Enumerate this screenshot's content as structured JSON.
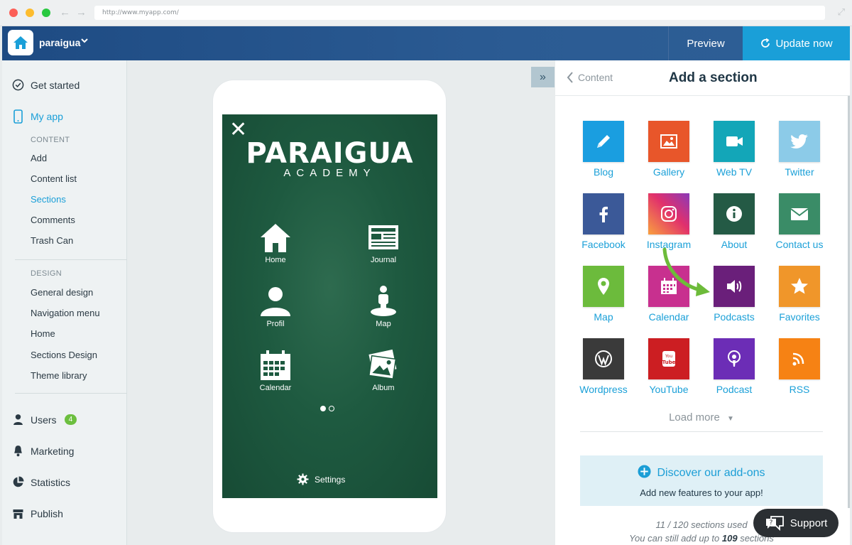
{
  "browser": {
    "url": "http://www.myapp.com/"
  },
  "header": {
    "app_name": "paraigua",
    "preview": "Preview",
    "update": "Update now"
  },
  "sidebar": {
    "get_started": "Get started",
    "my_app": "My app",
    "content_head": "CONTENT",
    "content_items": [
      "Add",
      "Content list",
      "Sections",
      "Comments",
      "Trash Can"
    ],
    "design_head": "DESIGN",
    "design_items": [
      "General design",
      "Navigation menu",
      "Home",
      "Sections Design",
      "Theme library"
    ],
    "users": "Users",
    "users_count": "4",
    "marketing": "Marketing",
    "statistics": "Statistics",
    "publish": "Publish"
  },
  "phone": {
    "brand": "PARAIGUA",
    "brand_sub": "ACADEMY",
    "items": [
      "Home",
      "Journal",
      "Profil",
      "Map",
      "Calendar",
      "Album"
    ],
    "settings": "Settings"
  },
  "panel": {
    "back": "Content",
    "title": "Add a section",
    "tiles": [
      {
        "label": "Blog",
        "color": "#1a9ee0",
        "icon": "pencil-icon"
      },
      {
        "label": "Gallery",
        "color": "#e8562a",
        "icon": "image-icon"
      },
      {
        "label": "Web TV",
        "color": "#13a6b8",
        "icon": "video-camera-icon"
      },
      {
        "label": "Twitter",
        "color": "#8ccbe8",
        "icon": "twitter-icon"
      },
      {
        "label": "Facebook",
        "color": "#3b5998",
        "icon": "facebook-icon"
      },
      {
        "label": "Instagram",
        "color": "#e1306c",
        "icon": "instagram-icon"
      },
      {
        "label": "About",
        "color": "#245a45",
        "icon": "info-icon"
      },
      {
        "label": "Contact us",
        "color": "#3a8c67",
        "icon": "envelope-icon"
      },
      {
        "label": "Map",
        "color": "#6cbb3c",
        "icon": "map-pin-icon"
      },
      {
        "label": "Calendar",
        "color": "#c8308f",
        "icon": "calendar-icon"
      },
      {
        "label": "Podcasts",
        "color": "#6a1f7a",
        "icon": "speaker-icon"
      },
      {
        "label": "Favorites",
        "color": "#f0962a",
        "icon": "star-icon"
      },
      {
        "label": "Wordpress",
        "color": "#3a3a3a",
        "icon": "wordpress-icon"
      },
      {
        "label": "YouTube",
        "color": "#cc1e22",
        "icon": "youtube-icon"
      },
      {
        "label": "Podcast",
        "color": "#6c2db6",
        "icon": "podcast-icon"
      },
      {
        "label": "RSS",
        "color": "#f68214",
        "icon": "rss-icon"
      }
    ],
    "load_more": "Load more",
    "addons_title": "Discover our add-ons",
    "addons_sub": "Add new features to your app!",
    "used_text": "11 / 120 sections used",
    "still_prefix": "You can still add up to ",
    "still_count": "109",
    "still_suffix": " sections"
  },
  "support": "Support"
}
